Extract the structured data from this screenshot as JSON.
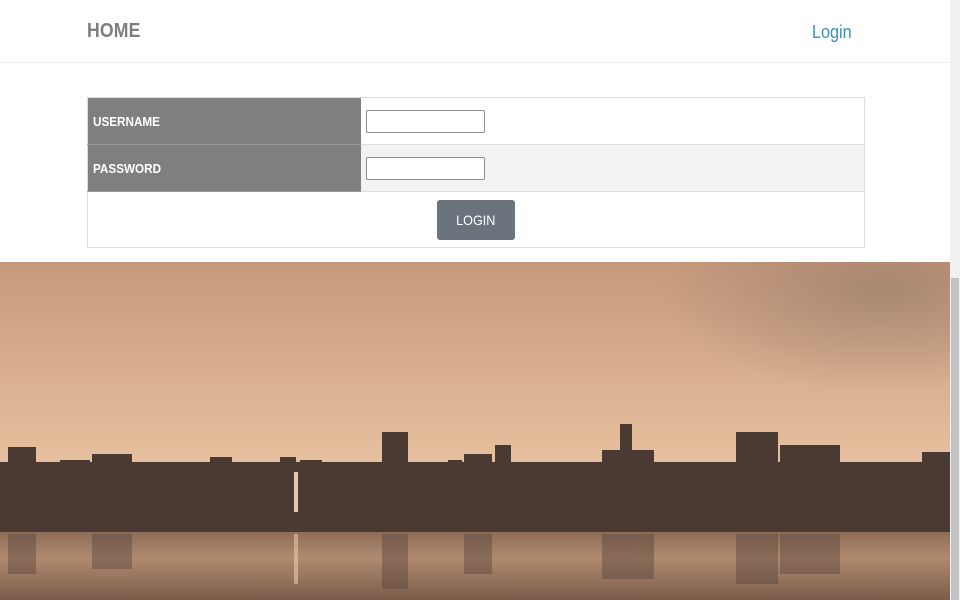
{
  "navbar": {
    "brand": "HOME",
    "login_link": "Login"
  },
  "login_form": {
    "username_label": "USERNAME",
    "password_label": "PASSWORD",
    "username_value": "",
    "password_value": "",
    "submit_label": "LOGIN"
  },
  "hero": {
    "description_icon": "city-skyline-image"
  },
  "colors": {
    "brand_text": "#7d7d7d",
    "link": "#3a8fb7",
    "label_bg": "#7f7f7f",
    "button_bg": "#6b737c"
  }
}
